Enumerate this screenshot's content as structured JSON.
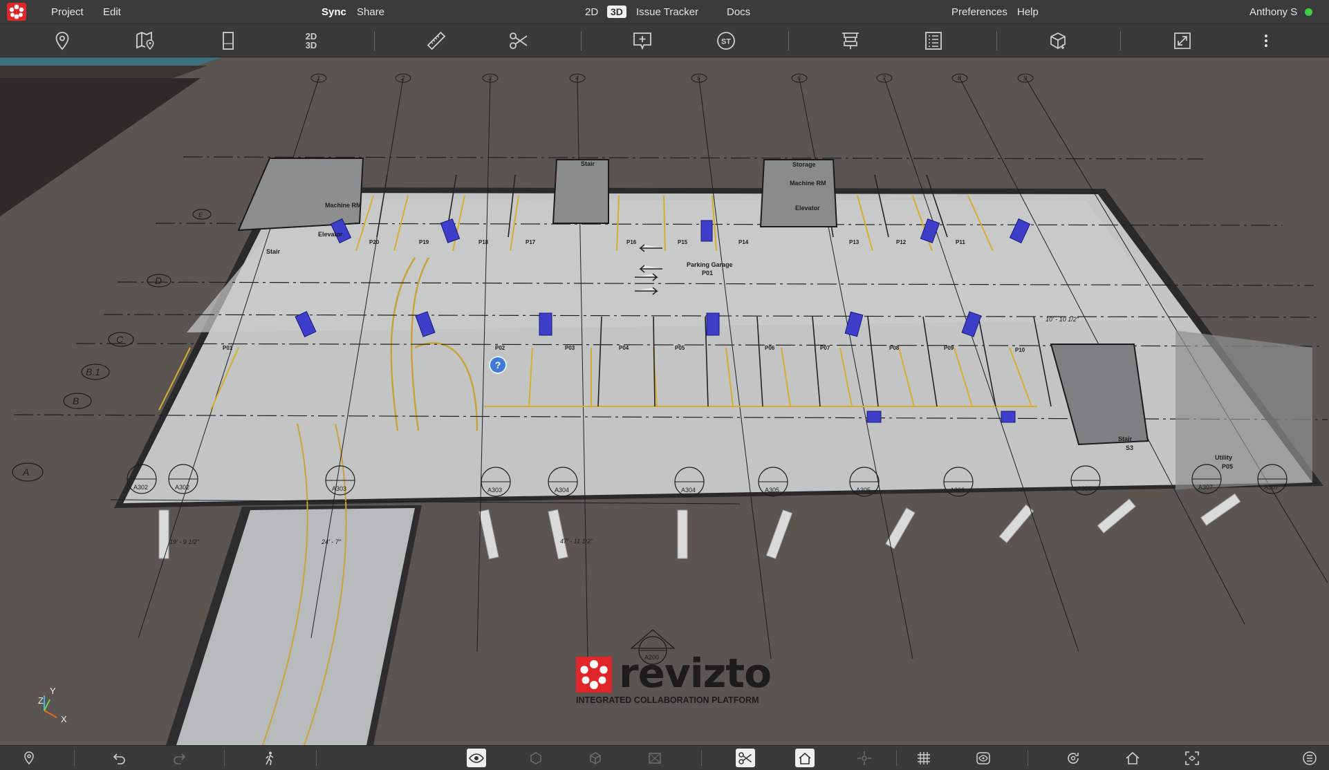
{
  "menubar": {
    "project": "Project",
    "edit": "Edit",
    "sync": "Sync",
    "share": "Share",
    "mode_2d": "2D",
    "mode_3d": "3D",
    "issue_tracker": "Issue Tracker",
    "docs": "Docs",
    "preferences": "Preferences",
    "help": "Help",
    "user": "Anthony S",
    "status_color": "#3fcf46"
  },
  "toolbar": {
    "toggle_2d3d_top": "2D",
    "toggle_2d3d_bottom": "3D",
    "issue_st": "ST",
    "icons": [
      "location-pin-icon",
      "map-pin-icon",
      "sheet-icon",
      "2d-3d-toggle",
      "ruler-icon",
      "scissors-icon",
      "add-issue-icon",
      "standards-icon",
      "levels-icon",
      "properties-list-icon",
      "section-box-icon",
      "resize-view-icon",
      "more-icon"
    ]
  },
  "drawing": {
    "room_machine_rm_1": "Machine RM",
    "room_elevator_1": "Elevator",
    "room_stair_1": "Stair",
    "room_stair_2": "Stair",
    "room_storage": "Storage",
    "room_machine_rm_2": "Machine RM",
    "room_elevator_2": "Elevator",
    "room_parking_garage": "Parking Garage",
    "room_parking_garage_tag": "P01",
    "room_stair_3": "Stair",
    "room_stair_3_tag": "S3",
    "room_utility": "Utility",
    "room_utility_tag": "P05",
    "stall_tags_top": [
      "P20",
      "P19",
      "P18",
      "P17",
      "P16",
      "P15",
      "P14",
      "P13",
      "P12",
      "P11"
    ],
    "stall_tags_bottom": [
      "P01",
      "P02",
      "P03",
      "P04",
      "P05",
      "P06",
      "P07",
      "P08",
      "P09",
      "P10"
    ],
    "grid_labels": [
      "E",
      "D",
      "C",
      "B.1",
      "B",
      "A"
    ],
    "column_labels": [
      "1",
      "2",
      "3",
      "4",
      "5",
      "6",
      "7",
      "8",
      "9"
    ],
    "section_tags": [
      "A302",
      "A302",
      "A303",
      "A303",
      "A304",
      "A304",
      "A305",
      "A305",
      "A306",
      "A306",
      "A307",
      "A307"
    ],
    "elevation_tag": "A200",
    "dim_1": "19' - 9 1/2\"",
    "dim_2": "24' - 7\"",
    "dim_3": "47' - 11 1/2\"",
    "dim_4": "10' - 10 1/2\""
  },
  "brand": {
    "name": "revizto",
    "tagline": "INTEGRATED COLLABORATION PLATFORM",
    "color": "#e0262b"
  },
  "gizmo": {
    "x": "X",
    "y": "Y",
    "z": "Z"
  },
  "bottombar": {
    "icons": [
      "location-pin-icon",
      "undo-icon",
      "redo-icon",
      "walk-mode-icon",
      "visibility-icon",
      "hide-icon",
      "isolate-icon",
      "ghost-icon",
      "section-cut-icon",
      "home-view-icon",
      "navigation-icon",
      "grid-icon",
      "appearance-icon",
      "rotate-icon",
      "home-icon",
      "focus-icon",
      "layers-icon"
    ]
  }
}
